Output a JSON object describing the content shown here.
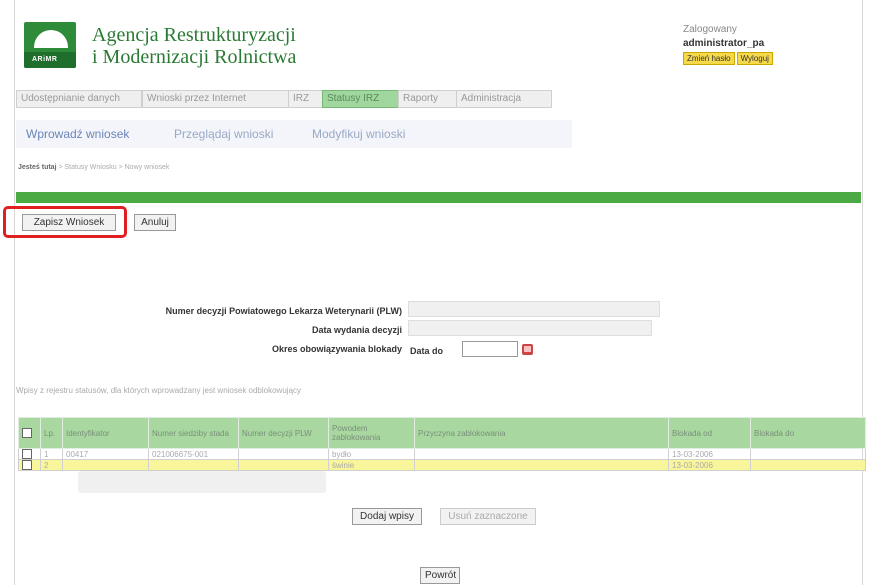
{
  "header": {
    "logo_text": "ARiMR",
    "agency_line1": "Agencja Restrukturyzacji",
    "agency_line2": "i Modernizacji Rolnictwa",
    "logged_label": "Zalogowany",
    "username": "administrator_pa",
    "btn_change_password": "Zmień hasło",
    "btn_logout": "Wyloguj"
  },
  "main_menu": [
    {
      "label": "Udostępnianie danych",
      "active": false
    },
    {
      "label": "Wnioski przez Internet",
      "active": false
    },
    {
      "label": "IRZ",
      "active": false
    },
    {
      "label": "Statusy IRZ",
      "active": true
    },
    {
      "label": "Raporty",
      "active": false
    },
    {
      "label": "Administracja",
      "active": false
    }
  ],
  "sub_tabs": [
    {
      "label": "Wprowadź wniosek",
      "active": true
    },
    {
      "label": "Przeglądaj wnioski",
      "active": false
    },
    {
      "label": "Modyfikuj wnioski",
      "active": false
    }
  ],
  "breadcrumb": {
    "home": "Jesteś tutaj",
    "trail": " > Statusy Wniosku > Nowy wniosek"
  },
  "actions": {
    "save_label": "Zapisz Wniosek",
    "cancel_label": "Anuluj"
  },
  "form": {
    "decision_label": "Numer decyzji Powiatowego Lekarza Weterynarii (PLW)",
    "date_label": "Data wydania decyzji",
    "period_label": "Okres obowiązywania blokady",
    "date_to_label": "Data do",
    "date_to_value": ""
  },
  "note": "Wpisy z rejestru statusów, dla których wprowadzany jest wniosek odblokowujący",
  "table": {
    "columns": [
      "",
      "Lp.",
      "Identyfikator",
      "Numer siedziby stada",
      "Numer decyzji PLW",
      "Powodem zablokowania",
      "Przyczyna zablokowania",
      "Blokada od",
      "Blokada do"
    ],
    "rows": [
      {
        "lp": "1",
        "identyfikator": "00417",
        "siedziba": "021006675-001",
        "decyzja": "",
        "powod": "bydło",
        "przyczyna": "",
        "od": "13-03-2006",
        "do": ""
      },
      {
        "lp": "2",
        "identyfikator": "",
        "siedziba": "",
        "decyzja": "",
        "powod": "świnie",
        "przyczyna": "",
        "od": "13-03-2006",
        "do": ""
      }
    ]
  },
  "bottom": {
    "add_entries": "Dodaj wpisy",
    "remove_selected": "Usuń zaznaczone",
    "back": "Powrót"
  },
  "colors": {
    "green_bar": "#4caa45",
    "active_menu": "#9fd79f",
    "table_header": "#a8d8a0",
    "highlight_row": "#f8f59a",
    "red_annotation": "#e02020"
  }
}
